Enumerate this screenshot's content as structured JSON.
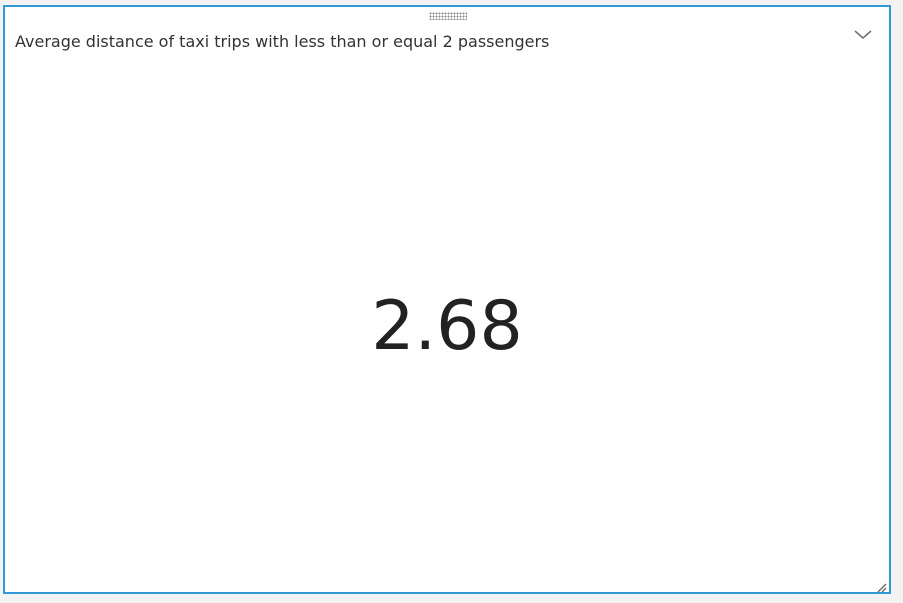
{
  "tile": {
    "title": "Average distance of taxi trips with less than or equal 2 passengers",
    "value": "2.68",
    "accent_color": "#2e9bd6",
    "icons": {
      "drag": "drag-handle-icon",
      "expand": "chevron-down-icon",
      "resize": "resize-grip-icon"
    }
  }
}
